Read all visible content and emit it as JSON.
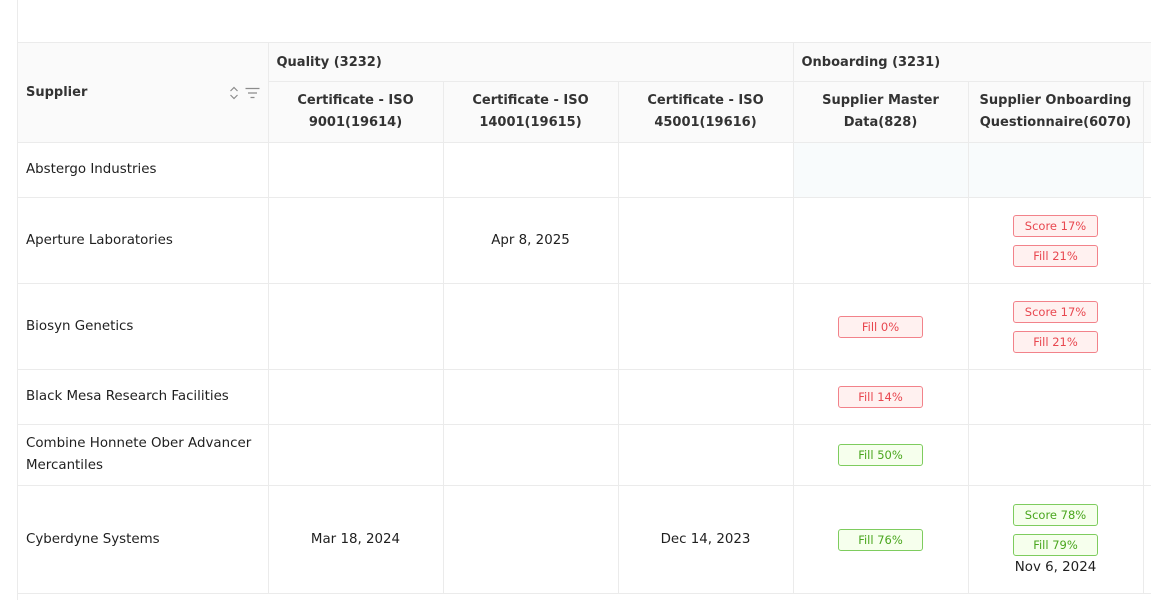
{
  "header": {
    "supplier_label": "Supplier",
    "groups": [
      {
        "label": "Quality (3232)"
      },
      {
        "label": "Onboarding (3231)"
      }
    ],
    "columns": [
      {
        "line1": "Certificate - ISO",
        "line2": "9001(19614)"
      },
      {
        "line1": "Certificate - ISO",
        "line2": "14001(19615)"
      },
      {
        "line1": "Certificate - ISO",
        "line2": "45001(19616)"
      },
      {
        "line1": "Supplier Master",
        "line2": "Data(828)"
      },
      {
        "line1": "Supplier Onboarding",
        "line2": "Questionnaire(6070)"
      }
    ]
  },
  "rows": [
    {
      "name_line1": "Abstergo Industries",
      "name_line2": "",
      "iso9001": "",
      "iso14001": "",
      "iso45001": "",
      "master": [],
      "questionnaire": [],
      "questionnaire_date": ""
    },
    {
      "name_line1": "Aperture Laboratories",
      "name_line2": "",
      "iso9001": "",
      "iso14001": "Apr 8, 2025",
      "iso45001": "",
      "master": [],
      "questionnaire": [
        {
          "text": "Score 17%",
          "status": "red"
        },
        {
          "text": "Fill 21%",
          "status": "red"
        }
      ],
      "questionnaire_date": ""
    },
    {
      "name_line1": "Biosyn Genetics",
      "name_line2": "",
      "iso9001": "",
      "iso14001": "",
      "iso45001": "",
      "master": [
        {
          "text": "Fill 0%",
          "status": "red"
        }
      ],
      "questionnaire": [
        {
          "text": "Score 17%",
          "status": "red"
        },
        {
          "text": "Fill 21%",
          "status": "red"
        }
      ],
      "questionnaire_date": ""
    },
    {
      "name_line1": "Black Mesa Research Facilities",
      "name_line2": "",
      "iso9001": "",
      "iso14001": "",
      "iso45001": "",
      "master": [
        {
          "text": "Fill 14%",
          "status": "red"
        }
      ],
      "questionnaire": [],
      "questionnaire_date": ""
    },
    {
      "name_line1": "Combine Honnete Ober Advancer",
      "name_line2": "Mercantiles",
      "iso9001": "",
      "iso14001": "",
      "iso45001": "",
      "master": [
        {
          "text": "Fill 50%",
          "status": "green"
        }
      ],
      "questionnaire": [],
      "questionnaire_date": ""
    },
    {
      "name_line1": "Cyberdyne Systems",
      "name_line2": "",
      "iso9001": "Mar 18, 2024",
      "iso14001": "",
      "iso45001": "Dec 14, 2023",
      "master": [
        {
          "text": "Fill 76%",
          "status": "green"
        }
      ],
      "questionnaire": [
        {
          "text": "Score 78%",
          "status": "green"
        },
        {
          "text": "Fill 79%",
          "status": "green"
        }
      ],
      "questionnaire_date": "Nov 6, 2024"
    }
  ],
  "icons": {
    "sort": "sort-icon",
    "filter": "filter-icon"
  },
  "colors": {
    "red_text": "#e8474f",
    "red_border": "#f2828a",
    "green_text": "#4aa61e",
    "green_border": "#7ecc5e"
  }
}
